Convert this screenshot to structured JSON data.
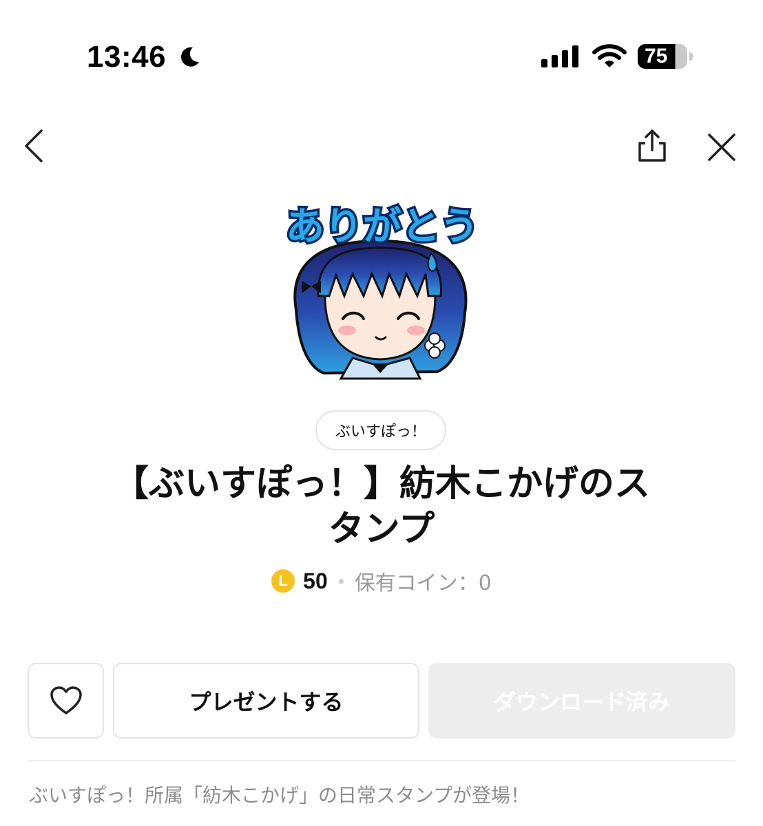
{
  "status_bar": {
    "time": "13:46",
    "battery_level": "75",
    "battery_fraction": 0.75
  },
  "nav": {
    "back_icon": "chevron-left-icon",
    "share_icon": "share-icon",
    "close_icon": "close-icon"
  },
  "sticker": {
    "banner_text": "ありがとう"
  },
  "product": {
    "tag": "ぶいすぽっ！",
    "title_line1": "【ぶいすぽっ！】紡木こかげのス",
    "title_line2": "タンプ",
    "coin_symbol": "L",
    "price": "50",
    "owned_coins": "保有コイン：0"
  },
  "actions": {
    "like_icon": "heart-icon",
    "present_label": "プレゼントする",
    "download_label": "ダウンロード済み"
  },
  "description": "ぶいすぽっ！所属「紡木こかげ」の日常スタンプが登場！",
  "colors": {
    "coin": "#f6c21f",
    "disabled_button": "#ededed",
    "text_primary": "#111111",
    "text_muted": "#8c8c8c",
    "sticker_blue": "#29a8e8",
    "hair_dark": "#1f2c7a"
  }
}
